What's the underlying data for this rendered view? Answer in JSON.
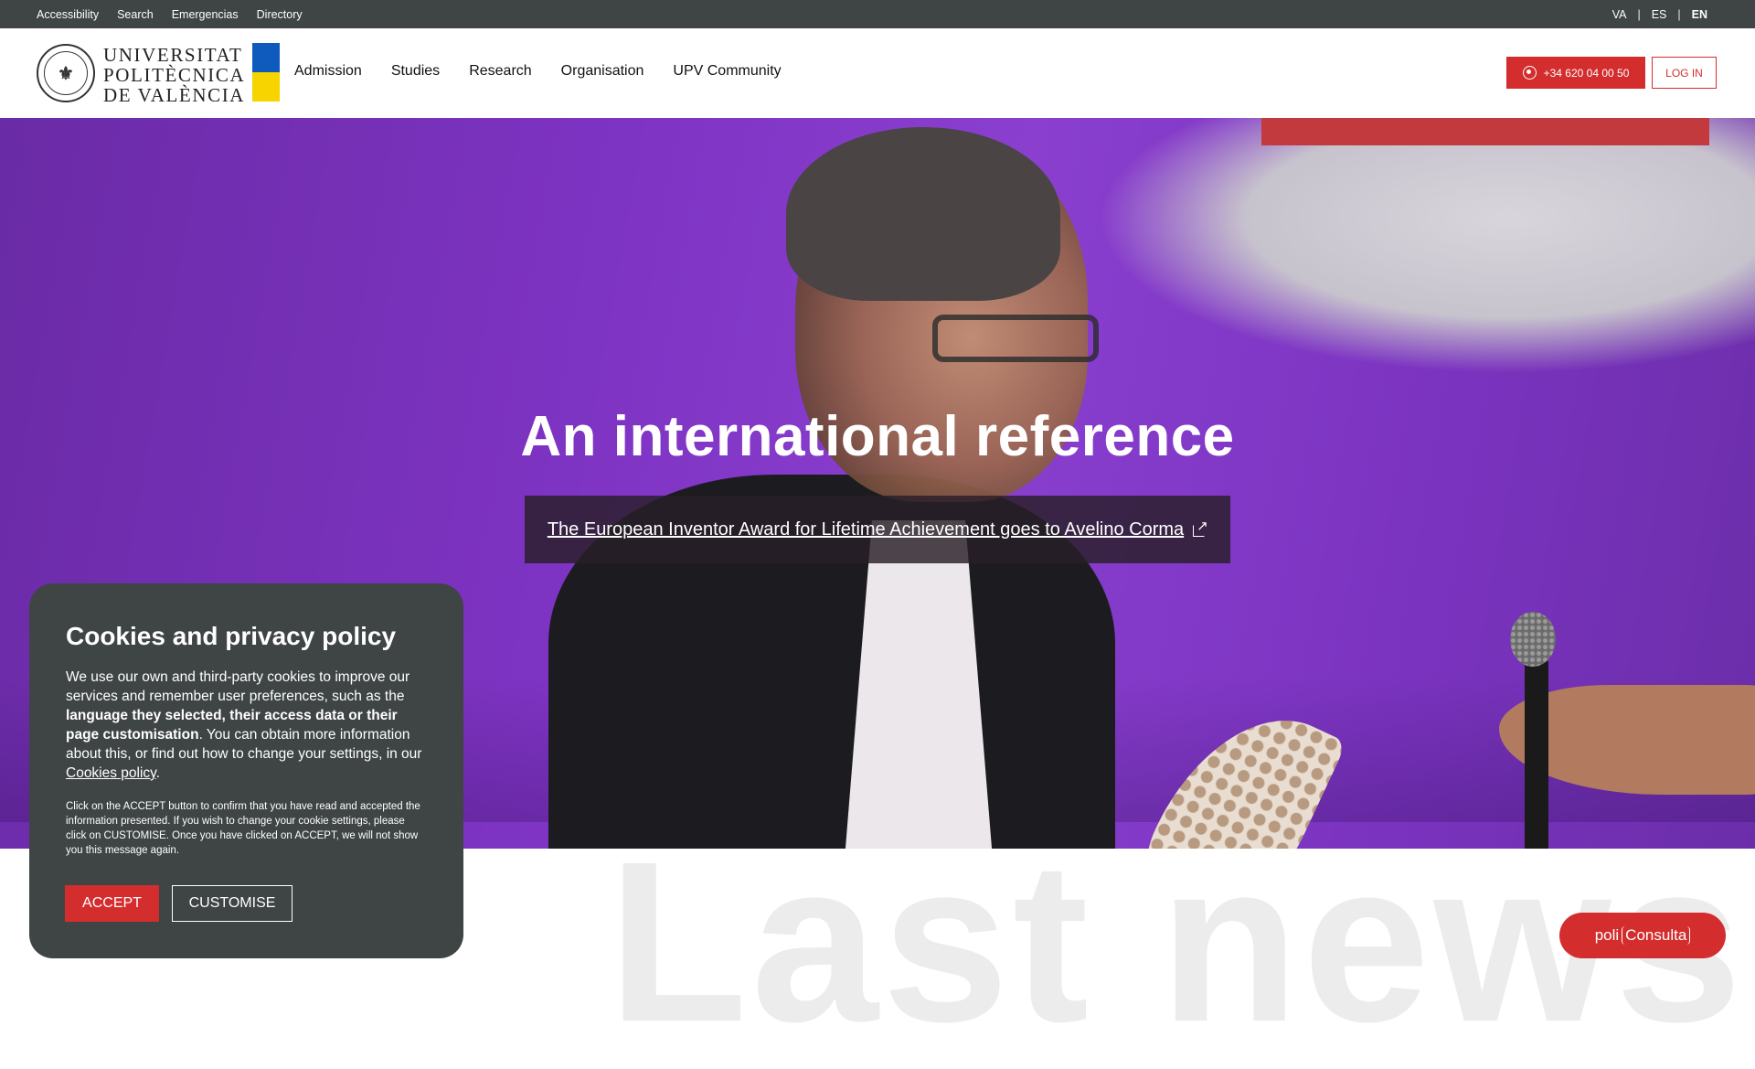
{
  "topbar": {
    "links": [
      "Accessibility",
      "Search",
      "Emergencias",
      "Directory"
    ],
    "languages": [
      "VA",
      "ES",
      "EN"
    ],
    "active_language": "EN"
  },
  "header": {
    "university_name_lines": [
      "UNIVERSITAT",
      "POLITÈCNICA",
      "DE VALÈNCIA"
    ],
    "nav": [
      "Admission",
      "Studies",
      "Research",
      "Organisation",
      "UPV Community"
    ],
    "phone_button": "+34 620 04 00 50",
    "login_button": "LOG IN",
    "brand_color": "#d42d2d",
    "flag_colors": [
      "#0f5bbd",
      "#f7d300"
    ]
  },
  "hero": {
    "title": "An international reference",
    "link_text": "The European Inventor Award for Lifetime Achievement goes to Avelino Corma"
  },
  "section": {
    "background_title": "Last news"
  },
  "cookie": {
    "title": "Cookies and privacy policy",
    "text_1": "We use our own and third-party cookies to improve our services and remember user preferences, such as the ",
    "text_bold": "language they selected, their access data or their page customisation",
    "text_2": ". You can obtain more information about this, or find out how to change your settings, in our ",
    "link": "Cookies policy",
    "text_3": ".",
    "small": "Click on the ACCEPT button to confirm that you have read and accepted the information presented. If you wish to change your cookie settings, please click on CUSTOMISE. Once you have clicked on ACCEPT, we will not show you this message again.",
    "accept": "ACCEPT",
    "customise": "CUSTOMISE"
  },
  "poli": {
    "prefix": "poli",
    "name": "Consulta"
  }
}
